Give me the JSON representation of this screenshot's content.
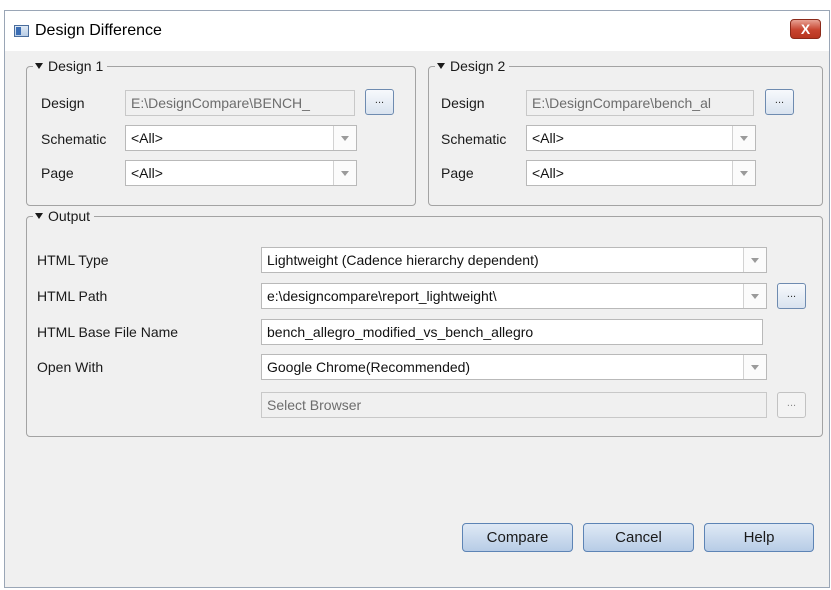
{
  "window": {
    "title": "Design Difference",
    "close_label": "X"
  },
  "design1": {
    "legend": "Design 1",
    "design_label": "Design",
    "design_value": "E:\\DesignCompare\\BENCH_",
    "schematic_label": "Schematic",
    "schematic_value": "<All>",
    "page_label": "Page",
    "page_value": "<All>",
    "browse_label": "..."
  },
  "design2": {
    "legend": "Design 2",
    "design_label": "Design",
    "design_value": "E:\\DesignCompare\\bench_al",
    "schematic_label": "Schematic",
    "schematic_value": "<All>",
    "page_label": "Page",
    "page_value": "<All>",
    "browse_label": "..."
  },
  "output": {
    "legend": "Output",
    "html_type_label": "HTML Type",
    "html_type_value": "Lightweight (Cadence hierarchy dependent)",
    "html_path_label": "HTML Path",
    "html_path_value": "e:\\designcompare\\report_lightweight\\",
    "html_base_label": "HTML Base File Name",
    "html_base_value": "bench_allegro_modified_vs_bench_allegro",
    "open_with_label": "Open With",
    "open_with_value": "Google Chrome(Recommended)",
    "select_browser_placeholder": "Select Browser",
    "path_browse_label": "...",
    "browser_browse_label": "..."
  },
  "buttons": {
    "compare": "Compare",
    "cancel": "Cancel",
    "help": "Help"
  }
}
